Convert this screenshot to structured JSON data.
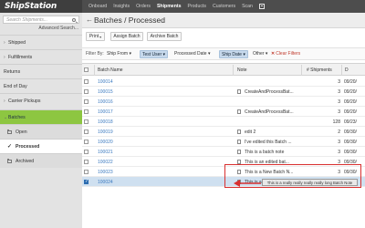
{
  "app": {
    "logo": "ShipStation"
  },
  "topnav": {
    "items": [
      {
        "label": "Onboard"
      },
      {
        "label": "Insights"
      },
      {
        "label": "Orders"
      },
      {
        "label": "Shipments",
        "active": true
      },
      {
        "label": "Products"
      },
      {
        "label": "Customers"
      },
      {
        "label": "Scan"
      }
    ]
  },
  "sidebar": {
    "search_placeholder": "Search Shipments...",
    "advanced_search": "Advanced Search...",
    "items": [
      {
        "label": "Shipped",
        "chevron": "›"
      },
      {
        "label": "Fulfillments",
        "chevron": "›"
      },
      {
        "label": "Returns",
        "chevron": ""
      },
      {
        "label": "End of Day",
        "chevron": ""
      },
      {
        "label": "Carrier Pickups",
        "chevron": "›"
      },
      {
        "label": "Batches",
        "chevron": "⌄"
      },
      {
        "label": "Open"
      },
      {
        "label": "Processed"
      },
      {
        "label": "Archived"
      }
    ]
  },
  "header": {
    "back": "←",
    "title": "Batches / Processed"
  },
  "toolbar": {
    "print": "Print",
    "print_caret": "▾",
    "assign": "Assign Batch",
    "archive": "Archive Batch"
  },
  "filters": {
    "label": "Filter By:",
    "ship_from": "Ship From ▾",
    "test_user": "Test User ▾",
    "processed_date": "Processed Date ▾",
    "ship_date": "Ship Date ▾",
    "other": "Other ▾",
    "clear": "Clear Filters",
    "clear_x": "✕"
  },
  "table": {
    "headers": {
      "name": "Batch Name",
      "note": "Note",
      "shipments": "# Shipments",
      "date": "D"
    },
    "rows": [
      {
        "name": "100014",
        "note": "",
        "shipments": "3",
        "date": "09/20/",
        "has_note_icon": false
      },
      {
        "name": "100015",
        "note": "CreateAndProcessBat...",
        "shipments": "3",
        "date": "09/20/",
        "has_note_icon": true
      },
      {
        "name": "100016",
        "note": "",
        "shipments": "3",
        "date": "09/20/",
        "has_note_icon": false
      },
      {
        "name": "100017",
        "note": "CreateAndProcessBat...",
        "shipments": "3",
        "date": "09/20/",
        "has_note_icon": true
      },
      {
        "name": "100018",
        "note": "",
        "shipments": "128",
        "date": "09/23/",
        "has_note_icon": false
      },
      {
        "name": "100019",
        "note": "edit 2",
        "shipments": "2",
        "date": "09/30/",
        "has_note_icon": true
      },
      {
        "name": "100020",
        "note": "I've edited this Batch ...",
        "shipments": "3",
        "date": "09/30/",
        "has_note_icon": true
      },
      {
        "name": "100021",
        "note": "This is a batch note",
        "shipments": "3",
        "date": "09/30/",
        "has_note_icon": true
      },
      {
        "name": "100022",
        "note": "This is an edited bat...",
        "shipments": "3",
        "date": "09/30/",
        "has_note_icon": true
      },
      {
        "name": "100023",
        "note": "This is a New Batch N...",
        "shipments": "3",
        "date": "09/30/",
        "has_note_icon": true
      },
      {
        "name": "100024",
        "note": "This is a really really r...",
        "shipments": "3",
        "date": "09/30/",
        "has_note_icon": true,
        "selected": true
      }
    ]
  },
  "tooltip": {
    "text": "This is a really really really really long Batch Note"
  },
  "colors": {
    "accent_green": "#8dc641",
    "link_blue": "#3b7ac0",
    "highlight_red": "#d93030",
    "selected_row": "#cfe0f0"
  }
}
